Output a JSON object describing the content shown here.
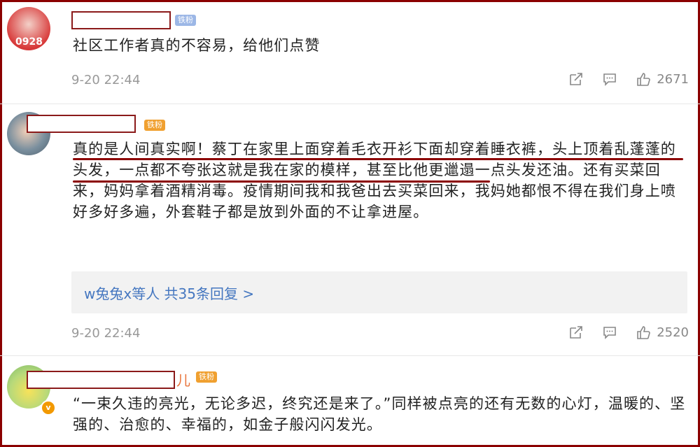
{
  "comments": [
    {
      "avatar_text": "0928",
      "badge": "铁粉",
      "text": "社区工作者真的不容易，给他们点赞",
      "time": "9-20 22:44",
      "likes": "2671"
    },
    {
      "badge": "铁粉",
      "text": "真的是人间真实啊！蔡丁在家里上面穿着毛衣开衫下面却穿着睡衣裤，头上顶着乱蓬蓬的头发，一点都不夸张这就是我在家的模样，甚至比他更邋遢一点头发还油。还有买菜回来，妈妈拿着酒精消毒。疫情期间我和我爸出去买菜回来，我妈她都恨不得在我们身上喷好多好多遍，外套鞋子都是放到外面的不让拿进屋。",
      "reply_summary": "w兔兔x等人  共35条回复 >",
      "time": "9-20 22:44",
      "likes": "2520"
    },
    {
      "name_fragment": "儿",
      "badge": "铁粉",
      "verified": "v",
      "text": "“一束久违的亮光，无论多迟，终究还是来了。”同样被点亮的还有无数的心灯，温暖的、坚强的、治愈的、幸福的，如金子般闪闪发光。"
    }
  ],
  "icons": [
    "share-icon",
    "comment-icon",
    "like-icon"
  ],
  "colors": {
    "border": "#8b0000",
    "link": "#4577c0",
    "meta": "#999999"
  }
}
